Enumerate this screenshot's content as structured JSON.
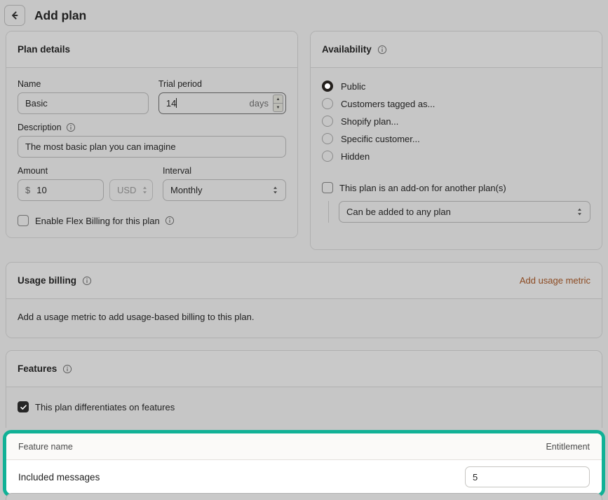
{
  "header": {
    "back_icon": "arrow-left-icon",
    "title": "Add plan"
  },
  "plan_details": {
    "title": "Plan details",
    "name": {
      "label": "Name",
      "value": "Basic"
    },
    "trial_period": {
      "label": "Trial period",
      "value": "14",
      "suffix": "days"
    },
    "description": {
      "label": "Description",
      "info_icon": "info-icon",
      "value": "The most basic plan you can imagine"
    },
    "amount": {
      "label": "Amount",
      "currency_symbol": "$",
      "value": "10"
    },
    "currency": {
      "selected": "USD",
      "disabled": true
    },
    "interval": {
      "label": "Interval",
      "selected": "Monthly"
    },
    "flex_billing": {
      "label": "Enable Flex Billing for this plan",
      "checked": false,
      "info_icon": "info-icon"
    }
  },
  "availability": {
    "title": "Availability",
    "info_icon": "info-icon",
    "options": [
      {
        "label": "Public",
        "selected": true
      },
      {
        "label": "Customers tagged as...",
        "selected": false
      },
      {
        "label": "Shopify plan...",
        "selected": false
      },
      {
        "label": "Specific customer...",
        "selected": false
      },
      {
        "label": "Hidden",
        "selected": false
      }
    ],
    "addon": {
      "label": "This plan is an add-on for another plan(s)",
      "checked": false,
      "select_value": "Can be added to any plan"
    }
  },
  "usage_billing": {
    "title": "Usage billing",
    "info_icon": "info-icon",
    "action_label": "Add usage metric",
    "empty_text": "Add a usage metric to add usage-based billing to this plan."
  },
  "features": {
    "title": "Features",
    "info_icon": "info-icon",
    "differentiates": {
      "label": "This plan differentiates on features",
      "checked": true
    },
    "table": {
      "columns": [
        "Feature name",
        "Entitlement"
      ],
      "rows": [
        {
          "name": "Included messages",
          "entitlement": "5"
        }
      ],
      "highlight_color": "#11b196"
    }
  }
}
